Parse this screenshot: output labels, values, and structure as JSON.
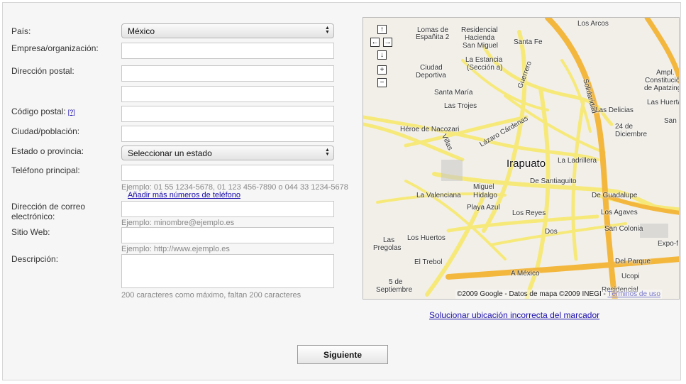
{
  "form": {
    "country_label": "País:",
    "country_value": "México",
    "company_label": "Empresa/organización:",
    "address_label": "Dirección postal:",
    "zip_label": "Código postal:",
    "zip_help": "[?]",
    "city_label": "Ciudad/población:",
    "state_label": "Estado o provincia:",
    "state_value": "Seleccionar un estado",
    "phone_label": "Teléfono principal:",
    "phone_hint": "Ejemplo: 01 55 1234-5678, 01 123 456-7890 o 044 33 1234-5678",
    "phone_more_link": "Añadir más números de teléfono",
    "email_label_line1": "Dirección de correo",
    "email_label_line2": "electrónico:",
    "email_hint": "Ejemplo: minombre@ejemplo.es",
    "web_label": "Sitio Web:",
    "web_hint": "Ejemplo: http://www.ejemplo.es",
    "desc_label": "Descripción:",
    "desc_hint": "200 caracteres como máximo, faltan 200 caracteres"
  },
  "map": {
    "city": "Irapuato",
    "labels": [
      "Los Arcos",
      "Lomas de",
      "Españita 2",
      "Residencial",
      "Hacienda",
      "San Miguel",
      "Santa Fe",
      "La Estancia",
      "(Sección a)",
      "Ciudad",
      "Deportiva",
      "Santa María",
      "Las Trojes",
      "Héroe de Nacozari",
      "Villas",
      "Lázaro Cárdenas",
      "Miguel",
      "Hidalgo",
      "La Valenciana",
      "Playa Azul",
      "Los Reyes",
      "Las Delicias",
      "24 de",
      "Diciembre",
      "La Ladrillera",
      "De Santiaguito",
      "De Guadalupe",
      "Los Agaves",
      "San Colonia",
      "Las",
      "Pregolas",
      "Los Huertos",
      "El Trebol",
      "5 de",
      "Septiembre",
      "Dos",
      "Del Parque",
      "Ucopi",
      "Residencial",
      "A México",
      "Ampl.",
      "Constitución",
      "de Apatzing",
      "Las Huerta",
      "San",
      "Expo-f",
      "Solidaridad",
      "Guerrero"
    ],
    "copyright": "©2009 Google - Datos de mapa ©2009 INEGI -",
    "terms": "Términos de uso",
    "fix_link": "Solucionar ubicación incorrecta del marcador"
  },
  "actions": {
    "next_label": "Siguiente"
  },
  "colors": {
    "road": "#f6e97a",
    "highway": "#f3b73e",
    "link": "#1a0dab"
  }
}
